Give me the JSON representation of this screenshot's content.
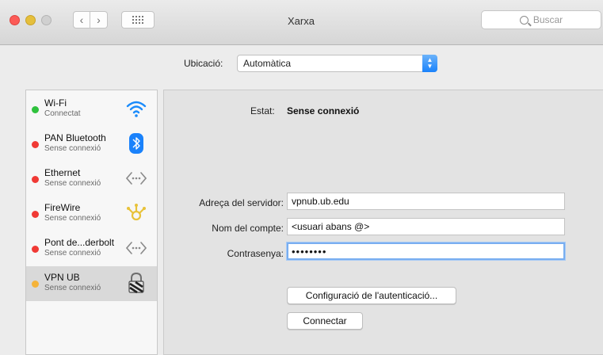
{
  "window": {
    "title": "Xarxa"
  },
  "toolbar": {
    "search_placeholder": "Buscar"
  },
  "location": {
    "label": "Ubicació:",
    "value": "Automàtica"
  },
  "services": [
    {
      "name": "Wi-Fi",
      "status": "Connectat",
      "dot": "#2fc23d",
      "icon": "wifi-icon"
    },
    {
      "name": "PAN Bluetooth",
      "status": "Sense connexió",
      "dot": "#f03a35",
      "icon": "bluetooth-icon"
    },
    {
      "name": "Ethernet",
      "status": "Sense connexió",
      "dot": "#f03a35",
      "icon": "ethernet-icon"
    },
    {
      "name": "FireWire",
      "status": "Sense connexió",
      "dot": "#f03a35",
      "icon": "firewire-icon"
    },
    {
      "name": "Pont de...derbolt",
      "status": "Sense connexió",
      "dot": "#f03a35",
      "icon": "thunderbolt-bridge-icon"
    },
    {
      "name": "VPN UB",
      "status": "Sense connexió",
      "dot": "#f5b339",
      "icon": "vpn-lock-icon"
    }
  ],
  "detail": {
    "status_label": "Estat:",
    "status_value": "Sense connexió",
    "server_label": "Adreça del servidor:",
    "server_value": "vpnub.ub.edu",
    "account_label": "Nom del compte:",
    "account_value": "<usuari abans @>",
    "password_label": "Contrasenya:",
    "password_value": "••••••••",
    "auth_button": "Configuració de l'autenticació...",
    "connect_button": "Connectar"
  },
  "colors": {
    "accent": "#1a82fb",
    "selected_row": "#d9d9d9"
  }
}
